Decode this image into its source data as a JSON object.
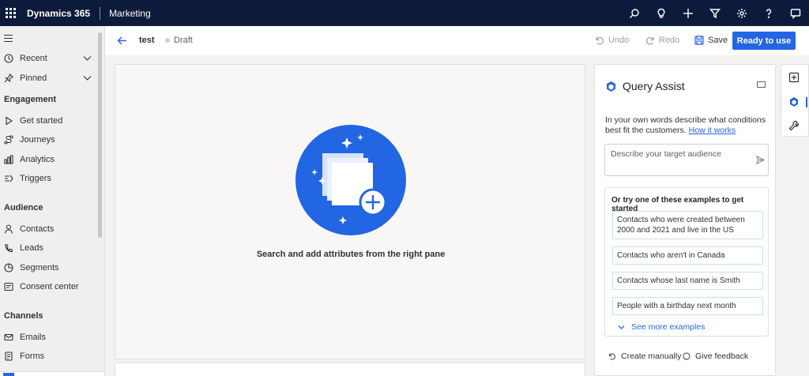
{
  "topbar": {
    "app_title": "Dynamics 365",
    "area_title": "Marketing",
    "icons": [
      "search-icon",
      "lightbulb-icon",
      "add-icon",
      "filter-icon",
      "gear-icon",
      "help-icon",
      "chat-icon"
    ]
  },
  "sidebar": {
    "recent": "Recent",
    "pinned": "Pinned",
    "engagement_header": "Engagement",
    "engagement_items": [
      "Get started",
      "Journeys",
      "Analytics",
      "Triggers"
    ],
    "audience_header": "Audience",
    "audience_items": [
      "Contacts",
      "Leads",
      "Segments",
      "Consent center"
    ],
    "channels_header": "Channels",
    "channels_items": [
      "Emails",
      "Forms"
    ]
  },
  "command": {
    "record_name": "test",
    "status": "Draft",
    "undo": "Undo",
    "redo": "Redo",
    "save": "Save",
    "ready": "Ready to use"
  },
  "canvas": {
    "message": "Search and add attributes from the right pane"
  },
  "query_assist": {
    "title": "Query Assist",
    "description": "In your own words describe what conditions best fit the customers.",
    "how_link": "How it works",
    "input_placeholder": "Describe your target audience",
    "examples_header": "Or try one of these examples to get started",
    "examples": [
      "Contacts who were created between 2000 and 2021 and live in the US",
      "Contacts who aren't in Canada",
      "Contacts whose last name is Smith",
      "People with a birthday next month"
    ],
    "see_more": "See more examples",
    "create_manually": "Create manually",
    "give_feedback": "Give feedback"
  },
  "colors": {
    "topbar": "#0d1a3b",
    "accent": "#2266e3"
  }
}
